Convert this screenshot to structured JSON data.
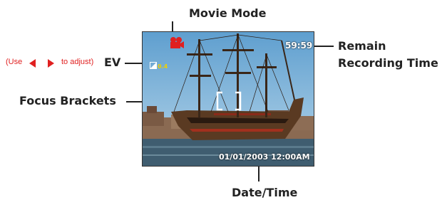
{
  "labels": {
    "movie_mode": "Movie Mode",
    "remain_line1": "Remain",
    "remain_line2": "Recording Time",
    "ev": "EV",
    "ev_note_prefix": "(Use",
    "ev_note_suffix": "to adjust)",
    "focus_brackets": "Focus Brackets",
    "date_time": "Date/Time"
  },
  "screen": {
    "remaining_time": "59:59",
    "ev_value": "0.4",
    "timestamp": "01/01/2003 12:00AM"
  },
  "colors": {
    "accent_red": "#e02020",
    "ev_yellow": "#f0d000"
  },
  "icons": [
    "movie-camera-icon",
    "ev-icon",
    "left-arrow-icon",
    "right-arrow-icon",
    "focus-brackets-icon"
  ]
}
